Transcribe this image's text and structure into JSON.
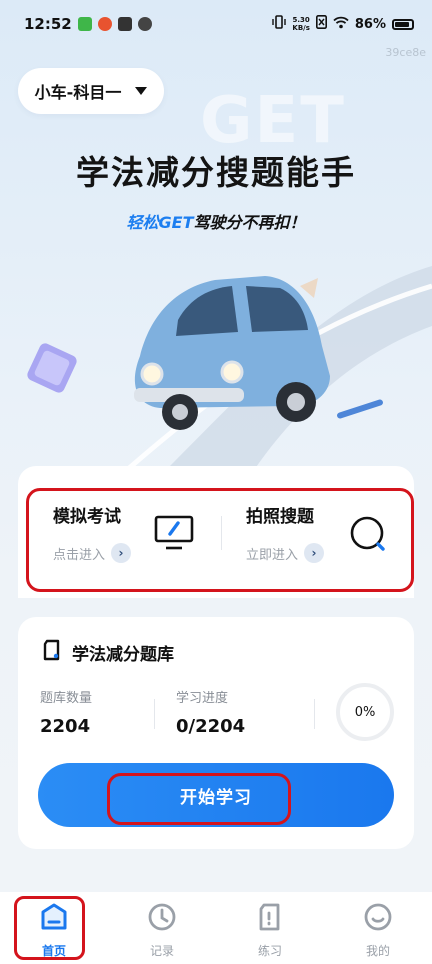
{
  "status_bar": {
    "time": "12:52",
    "net_speed_value": "5.30",
    "net_speed_unit": "KB/s",
    "battery": "86%"
  },
  "watermark": "39ce8e",
  "subject_selector": {
    "label": "小车-科目一"
  },
  "hero": {
    "background_text": "GET",
    "title": "学法减分搜题能手",
    "subtitle_highlight": "轻松GET",
    "subtitle_rest": "驾驶分不再扣！"
  },
  "entries": [
    {
      "title": "模拟考试",
      "link": "点击进入",
      "icon": "monitor-pen-icon"
    },
    {
      "title": "拍照搜题",
      "link": "立即进入",
      "icon": "search-scan-icon"
    }
  ],
  "question_bank": {
    "title": "学法减分题库",
    "stats": [
      {
        "label": "题库数量",
        "value": "2204"
      },
      {
        "label": "学习进度",
        "value": "0/2204"
      }
    ],
    "progress_percent_label": "0%",
    "progress_fraction": 0,
    "start_button": "开始学习"
  },
  "tabs": [
    {
      "label": "首页",
      "icon": "home-icon",
      "active": true
    },
    {
      "label": "记录",
      "icon": "history-icon",
      "active": false
    },
    {
      "label": "练习",
      "icon": "practice-icon",
      "active": false
    },
    {
      "label": "我的",
      "icon": "profile-icon",
      "active": false
    }
  ],
  "colors": {
    "accent": "#1a78ee",
    "highlight_outline": "#d4141c",
    "card": "#ffffff"
  }
}
